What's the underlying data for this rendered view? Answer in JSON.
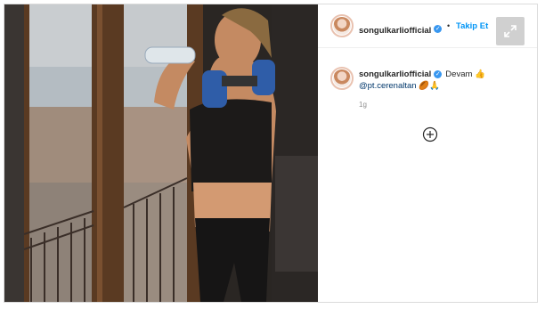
{
  "post": {
    "username": "songulkarliofficial",
    "dot": "•",
    "follow_label": "Takip Et",
    "caption": "Devam 👍",
    "mention": "@pt.cerenaltan",
    "caption_emojis": "🏉🙏",
    "time_ago": "1g"
  },
  "icons": {
    "verified": "verified-badge-icon",
    "expand": "expand-icon",
    "load_more": "plus-circle-icon"
  },
  "colors": {
    "follow": "#0095f6",
    "verified": "#3897f0",
    "text": "#262626",
    "meta": "#8e8e8e"
  }
}
